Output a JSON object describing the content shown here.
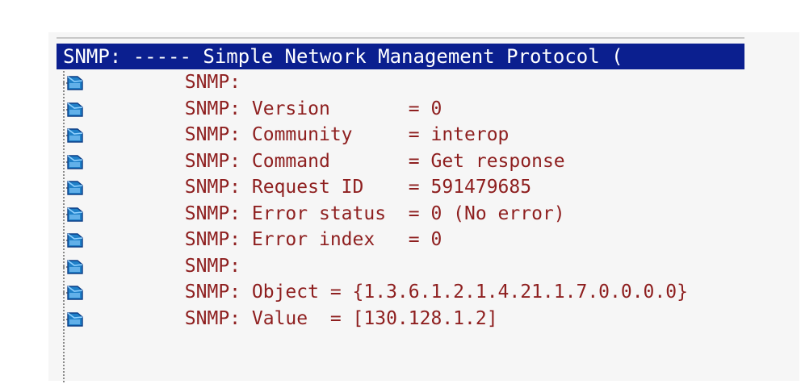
{
  "window": {
    "header": "SNMP: ----- Simple Network Management Protocol ("
  },
  "rows": [
    {
      "prefix": "SNMP:",
      "label": "",
      "sep": "",
      "value": ""
    },
    {
      "prefix": "SNMP:",
      "label": "Version       ",
      "sep": "= ",
      "value": "0"
    },
    {
      "prefix": "SNMP:",
      "label": "Community     ",
      "sep": "= ",
      "value": "interop"
    },
    {
      "prefix": "SNMP:",
      "label": "Command       ",
      "sep": "= ",
      "value": "Get response"
    },
    {
      "prefix": "SNMP:",
      "label": "Request ID    ",
      "sep": "= ",
      "value": "591479685"
    },
    {
      "prefix": "SNMP:",
      "label": "Error status  ",
      "sep": "= ",
      "value": "0 (No error)"
    },
    {
      "prefix": "SNMP:",
      "label": "Error index   ",
      "sep": "= ",
      "value": "0"
    },
    {
      "prefix": "SNMP:",
      "label": "",
      "sep": "",
      "value": ""
    },
    {
      "prefix": "SNMP:",
      "label": "Object ",
      "sep": "= ",
      "value": "{1.3.6.1.2.1.4.21.1.7.0.0.0.0}"
    },
    {
      "prefix": "SNMP:",
      "label": "Value  ",
      "sep": "= ",
      "value": "[130.128.1.2]"
    }
  ],
  "icon": {
    "name": "packet-node-icon",
    "color_main": "#1f80c8",
    "color_dark": "#0d3e86",
    "color_light": "#8fd0ff"
  },
  "colors": {
    "header_bg": "#0b1f8f",
    "text": "#8e1f1f"
  }
}
